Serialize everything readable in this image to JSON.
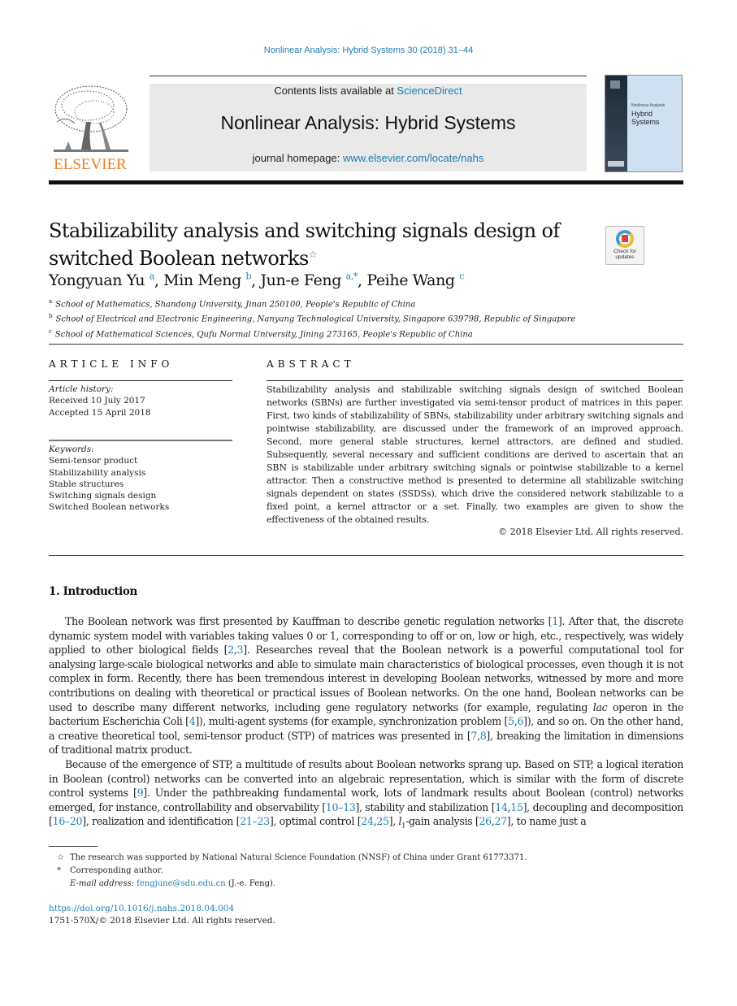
{
  "running_head": "Nonlinear Analysis: Hybrid Systems 30 (2018) 31–44",
  "masthead": {
    "publisher_logo_text": "ELSEVIER",
    "contents_prefix": "Contents lists available at ",
    "contents_link": "ScienceDirect",
    "journal_title": "Nonlinear Analysis: Hybrid Systems",
    "homepage_prefix": "journal homepage: ",
    "homepage_link": "www.elsevier.com/locate/nahs",
    "cover": {
      "subtitle": "Nonlinear Analysis",
      "title_line1": "Hybrid",
      "title_line2": "Systems"
    }
  },
  "article": {
    "title_line1": "Stabilizability analysis and switching signals design of",
    "title_line2": "switched Boolean networks",
    "title_note_mark": "☆",
    "check_updates_line1": "Check for",
    "check_updates_line2": "updates",
    "authors": [
      {
        "name": "Yongyuan Yu",
        "sup": "a",
        "sep": ", "
      },
      {
        "name": "Min Meng",
        "sup": "b",
        "sep": ", "
      },
      {
        "name": "Jun-e Feng",
        "sup": "a,*",
        "sep": ", "
      },
      {
        "name": "Peihe Wang",
        "sup": "c",
        "sep": ""
      }
    ],
    "affiliations": [
      {
        "mark": "a",
        "text": "School of Mathematics, Shandong University, Jinan 250100, People's Republic of China"
      },
      {
        "mark": "b",
        "text": "School of Electrical and Electronic Engineering, Nanyang Technological University, Singapore 639798, Republic of Singapore"
      },
      {
        "mark": "c",
        "text": "School of Mathematical Sciences, Qufu Normal University, Jining 273165, People's Republic of China"
      }
    ]
  },
  "article_info": {
    "heading": "ARTICLE INFO",
    "history_label": "Article history:",
    "received": "Received 10 July 2017",
    "accepted": "Accepted 15 April 2018",
    "keywords_label": "Keywords:",
    "keywords": [
      "Semi-tensor product",
      "Stabilizability analysis",
      "Stable structures",
      "Switching signals design",
      "Switched Boolean networks"
    ]
  },
  "abstract": {
    "heading": "ABSTRACT",
    "text": "Stabilizability analysis and stabilizable switching signals design of switched Boolean networks (SBNs) are further investigated via semi-tensor product of matrices in this paper. First, two kinds of stabilizability of SBNs, stabilizability under arbitrary switching signals and pointwise stabilizability, are discussed under the framework of an improved approach. Second, more general stable structures, kernel attractors, are defined and studied. Subsequently, several necessary and sufficient conditions are derived to ascertain that an SBN is stabilizable under arbitrary switching signals or pointwise stabilizable to a kernel attractor. Then a constructive method is presented to determine all stabilizable switching signals dependent on states (SSDSs), which drive the considered network stabilizable to a fixed point, a kernel attractor or a set. Finally, two examples are given to show the effectiveness of the obtained results.",
    "copyright": "© 2018 Elsevier Ltd. All rights reserved."
  },
  "introduction": {
    "heading": "1.  Introduction",
    "p1": [
      {
        "t": "The Boolean network was first presented by Kauffman to describe genetic regulation networks ["
      },
      {
        "t": "1",
        "ref": true
      },
      {
        "t": "]. After that, the discrete dynamic system model with variables taking values 0 or 1, corresponding to off or on, low or high, etc., respectively, was widely applied to other biological fields ["
      },
      {
        "t": "2",
        "ref": true
      },
      {
        "t": ","
      },
      {
        "t": "3",
        "ref": true
      },
      {
        "t": "]. Researches reveal that the Boolean network is a powerful computational tool for analysing large-scale biological networks and able to simulate main characteristics of biological processes, even though it is not complex in form. Recently, there has been tremendous interest in developing Boolean networks, witnessed by more and more contributions on dealing with theoretical or practical issues of Boolean networks. On the one hand, Boolean networks can be used to describe many different networks, including gene regulatory networks (for example, regulating "
      },
      {
        "t": "lac",
        "italic": true
      },
      {
        "t": " operon in the bacterium Escherichia Coli ["
      },
      {
        "t": "4",
        "ref": true
      },
      {
        "t": "]), multi-agent systems (for example, synchronization problem ["
      },
      {
        "t": "5",
        "ref": true
      },
      {
        "t": ","
      },
      {
        "t": "6",
        "ref": true
      },
      {
        "t": "]), and so on. On the other hand, a creative theoretical tool, semi-tensor product (STP) of matrices was presented in ["
      },
      {
        "t": "7",
        "ref": true
      },
      {
        "t": ","
      },
      {
        "t": "8",
        "ref": true
      },
      {
        "t": "], breaking the limitation in dimensions of traditional matrix product."
      }
    ],
    "p2": [
      {
        "t": "Because of the emergence of STP, a multitude of results about Boolean networks sprang up. Based on STP, a logical iteration in Boolean (control) networks can be converted into an algebraic representation, which is similar with the form of discrete control systems ["
      },
      {
        "t": "9",
        "ref": true
      },
      {
        "t": "]. Under the pathbreaking fundamental work, lots of landmark results about Boolean (control) networks emerged, for instance, controllability and observability ["
      },
      {
        "t": "10–13",
        "ref": true
      },
      {
        "t": "], stability and stabilization ["
      },
      {
        "t": "14",
        "ref": true
      },
      {
        "t": ","
      },
      {
        "t": "15",
        "ref": true
      },
      {
        "t": "], decoupling and decomposition ["
      },
      {
        "t": "16–20",
        "ref": true
      },
      {
        "t": "], realization and identification ["
      },
      {
        "t": "21–23",
        "ref": true
      },
      {
        "t": "], optimal control ["
      },
      {
        "t": "24",
        "ref": true
      },
      {
        "t": ","
      },
      {
        "t": "25",
        "ref": true
      },
      {
        "t": "], "
      },
      {
        "t": "l",
        "italic": true
      },
      {
        "t": "1",
        "sub": true
      },
      {
        "t": "-gain analysis ["
      },
      {
        "t": "26",
        "ref": true
      },
      {
        "t": ","
      },
      {
        "t": "27",
        "ref": true
      },
      {
        "t": "], to name just a"
      }
    ]
  },
  "footnotes": {
    "funding_mark": "☆",
    "funding": "The research was supported by National Natural Science Foundation (NNSF) of China under Grant 61773371.",
    "corresponding_mark": "*",
    "corresponding": "Corresponding author.",
    "email_label": "E-mail address: ",
    "email": "fengjune@sdu.edu.cn",
    "email_suffix": " (J.-e. Feng)."
  },
  "doi": {
    "link": "https://doi.org/10.1016/j.nahs.2018.04.004",
    "issn_line": "1751-570X/© 2018 Elsevier Ltd. All rights reserved."
  },
  "colors": {
    "link": "#1f7eb1",
    "elsevier_orange": "#f07e26",
    "masthead_bg": "#e9e9e9"
  }
}
